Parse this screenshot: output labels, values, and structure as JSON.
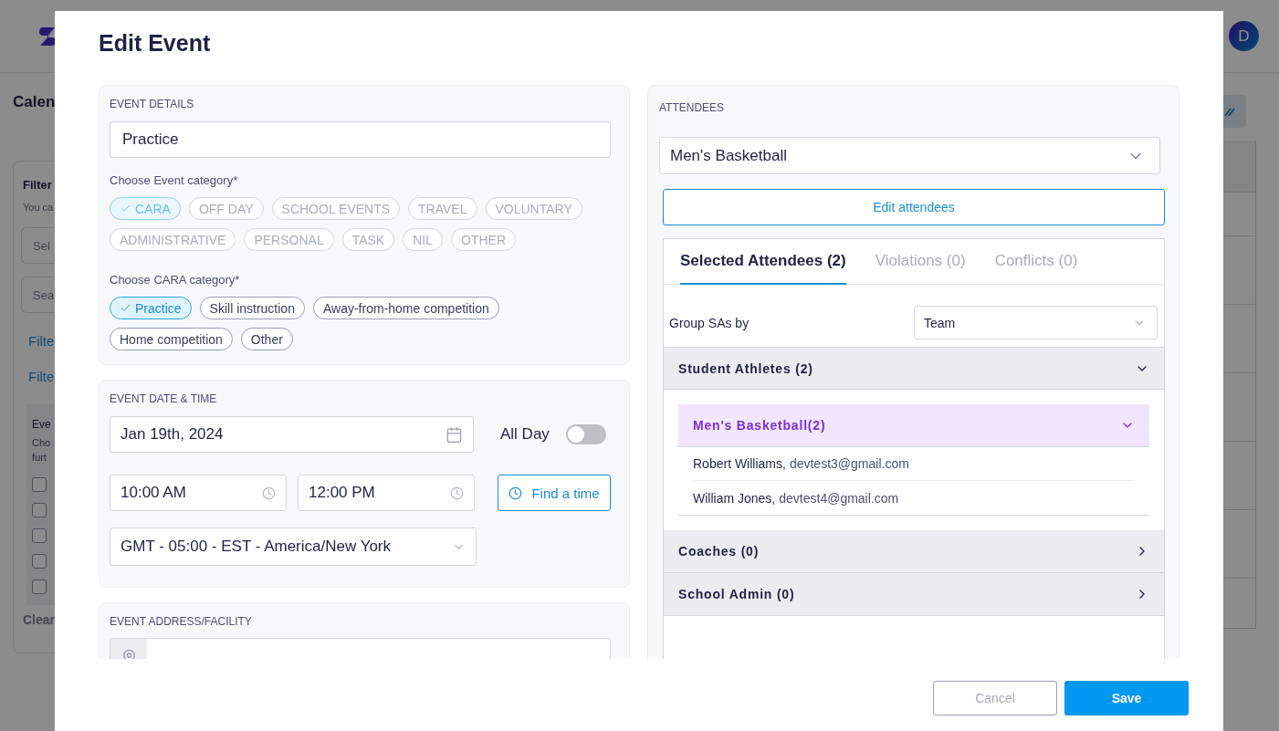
{
  "background": {
    "page_title": "Calen",
    "filters": {
      "title": "Filter",
      "hint": "You ca",
      "select_placeholder": "Sel",
      "search_placeholder": "Sea",
      "links": [
        "Filte",
        "Filte"
      ],
      "events": {
        "title": "Eve",
        "text": [
          "Cho",
          "furt"
        ],
        "checkboxes": [
          {
            "checked": false
          },
          {
            "checked": false
          },
          {
            "checked": false
          },
          {
            "checked": false
          },
          {
            "checked": false
          }
        ]
      },
      "clear": "Clear"
    },
    "avatar": "D"
  },
  "modal": {
    "title": "Edit Event",
    "event_details": {
      "heading": "EVENT DETAILS",
      "name": "Practice",
      "event_category": {
        "label": "Choose Event category*",
        "disabled": true,
        "options": [
          {
            "label": "CARA",
            "selected": true
          },
          {
            "label": "OFF DAY",
            "selected": false
          },
          {
            "label": "SCHOOL EVENTS",
            "selected": false
          },
          {
            "label": "TRAVEL",
            "selected": false
          },
          {
            "label": "VOLUNTARY",
            "selected": false
          },
          {
            "label": "ADMINISTRATIVE",
            "selected": false
          },
          {
            "label": "PERSONAL",
            "selected": false
          },
          {
            "label": "TASK",
            "selected": false
          },
          {
            "label": "NIL",
            "selected": false
          },
          {
            "label": "OTHER",
            "selected": false
          }
        ]
      },
      "cara_category": {
        "label": "Choose CARA category*",
        "disabled": false,
        "options": [
          {
            "label": "Practice",
            "selected": true
          },
          {
            "label": "Skill instruction",
            "selected": false
          },
          {
            "label": "Away-from-home competition",
            "selected": false
          },
          {
            "label": "Home competition",
            "selected": false
          },
          {
            "label": "Other",
            "selected": false
          }
        ]
      }
    },
    "date_time": {
      "heading": "EVENT DATE & TIME",
      "date": "Jan 19th, 2024",
      "all_day": {
        "label": "All Day",
        "on": false
      },
      "start_time": "10:00 AM",
      "end_time": "12:00 PM",
      "find_time": "Find a time",
      "timezone": "GMT - 05:00 - EST - America/New York"
    },
    "address": {
      "heading": "EVENT ADDRESS/FACILITY"
    },
    "attendees": {
      "heading": "ATTENDEES",
      "team": "Men's Basketball",
      "edit_button": "Edit attendees",
      "tabs": [
        {
          "label": "Selected Attendees (2)",
          "selected": true
        },
        {
          "label": "Violations (0)",
          "selected": false
        },
        {
          "label": "Conflicts (0)",
          "selected": false
        }
      ],
      "group_by": {
        "label": "Group SAs by",
        "value": "Team"
      },
      "groups": [
        {
          "title": "Student Athletes (2)",
          "expanded": true,
          "children": [
            {
              "title": "Men's Basketball(2)",
              "expanded": true,
              "members": [
                {
                  "name": "Robert Williams,",
                  "email": "devtest3@gmail.com"
                },
                {
                  "name": "William Jones,",
                  "email": "devtest4@gmail.com"
                }
              ]
            }
          ]
        },
        {
          "title": "Coaches (0)",
          "expanded": false
        },
        {
          "title": "School Admin (0)",
          "expanded": false
        }
      ]
    },
    "buttons": {
      "cancel": "Cancel",
      "save": "Save"
    }
  }
}
